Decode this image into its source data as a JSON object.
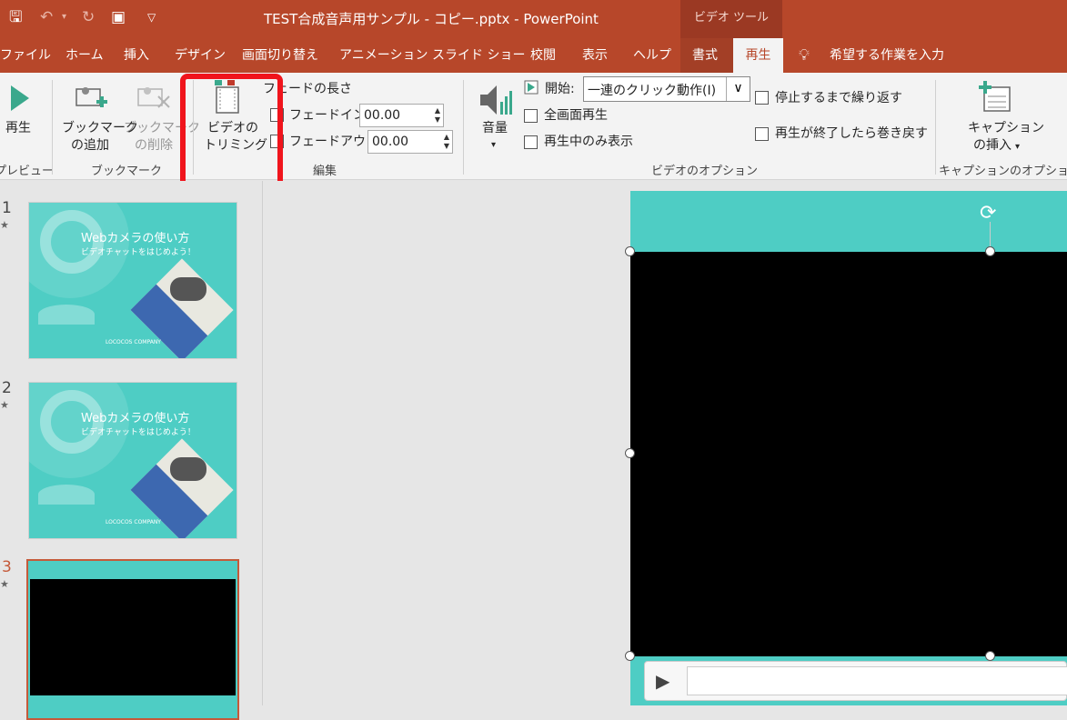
{
  "app": {
    "title": "TEST合成音声用サンプル - コピー.pptx  -  PowerPoint",
    "context_tab_header": "ビデオ ツール"
  },
  "qat": {
    "save_icon": "save-icon",
    "undo_icon": "undo-icon",
    "redo_icon": "redo-icon",
    "present_icon": "present-from-start-icon",
    "customize_icon": "customize-qat-icon"
  },
  "tabs": [
    "ファイル",
    "ホーム",
    "挿入",
    "デザイン",
    "画面切り替え",
    "アニメーション",
    "スライド ショー",
    "校閲",
    "表示",
    "ヘルプ",
    "書式",
    "再生"
  ],
  "tell_me": "希望する作業を入力",
  "ribbon": {
    "preview": {
      "play": "再生",
      "group": "プレビュー"
    },
    "bookmark": {
      "add": "ブックマーク\nの追加",
      "add_l1": "ブックマーク",
      "add_l2": "の追加",
      "remove_l1": "ブックマーク",
      "remove_l2": "の削除",
      "group": "ブックマーク"
    },
    "edit": {
      "trim_l1": "ビデオの",
      "trim_l2": "トリミング",
      "fade_title": "フェードの長さ",
      "fade_in_label": "フェードイン:",
      "fade_in_value": "00.00",
      "fade_out_label": "フェードアウト:",
      "fade_out_value": "00.00",
      "group": "編集"
    },
    "options": {
      "volume": "音量",
      "start_label": "開始:",
      "start_value": "一連のクリック動作(I)",
      "fullscreen": "全画面再生",
      "hide_not_playing": "再生中のみ表示",
      "loop": "停止するまで繰り返す",
      "rewind": "再生が終了したら巻き戻す",
      "group": "ビデオのオプション"
    },
    "captions": {
      "insert_l1": "キャプション",
      "insert_l2": "の挿入",
      "group": "キャプションのオプション"
    }
  },
  "slides": [
    {
      "num": "1",
      "star": "★",
      "title": "Webカメラの使い方",
      "subtitle": "ビデオチャットをはじめよう！",
      "company": "LOCOCOS COMPANY"
    },
    {
      "num": "2",
      "star": "★",
      "title": "Webカメラの使い方",
      "subtitle": "ビデオチャットをはじめよう！",
      "company": "LOCOCOS COMPANY"
    },
    {
      "num": "3",
      "star": "★"
    }
  ],
  "colors": {
    "accent": "#b7472a",
    "slide_teal": "#4ecdc4",
    "highlight": "#f0141c"
  }
}
